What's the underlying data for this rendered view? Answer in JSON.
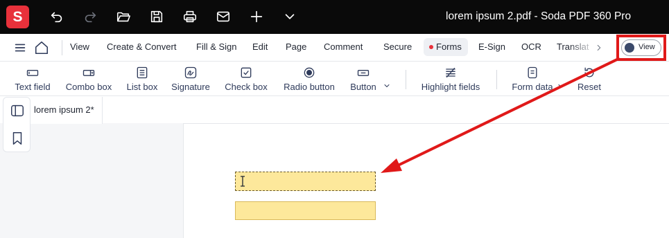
{
  "titlebar": {
    "logo_letter": "S",
    "title": "lorem ipsum 2.pdf  -  Soda PDF 360 Pro",
    "icons": [
      "undo-icon",
      "redo-icon",
      "folder-open-icon",
      "save-icon",
      "print-icon",
      "mail-icon",
      "plus-icon",
      "chevron-down-icon"
    ]
  },
  "menu": {
    "items": [
      "View",
      "Create & Convert",
      "Fill & Sign",
      "Edit",
      "Page",
      "Comment",
      "Secure",
      "Forms",
      "E-Sign",
      "OCR",
      "Translat"
    ],
    "active": "Forms",
    "view_toggle_label": "View"
  },
  "toolbar": {
    "tools": [
      {
        "label": "Text field",
        "icon": "text-field-icon"
      },
      {
        "label": "Combo box",
        "icon": "combo-box-icon"
      },
      {
        "label": "List box",
        "icon": "list-box-icon"
      },
      {
        "label": "Signature",
        "icon": "signature-icon"
      },
      {
        "label": "Check box",
        "icon": "check-box-icon"
      },
      {
        "label": "Radio button",
        "icon": "radio-button-icon"
      },
      {
        "label": "Button",
        "icon": "button-icon"
      },
      {
        "label": "Highlight fields",
        "icon": "highlight-fields-icon"
      },
      {
        "label": "Form data",
        "icon": "form-data-icon"
      },
      {
        "label": "Reset",
        "icon": "reset-icon"
      }
    ]
  },
  "document": {
    "tab_label": "lorem ipsum 2*"
  },
  "colors": {
    "accent": "#e8313b",
    "field_fill": "#fde89b",
    "annotation": "#e01919"
  }
}
